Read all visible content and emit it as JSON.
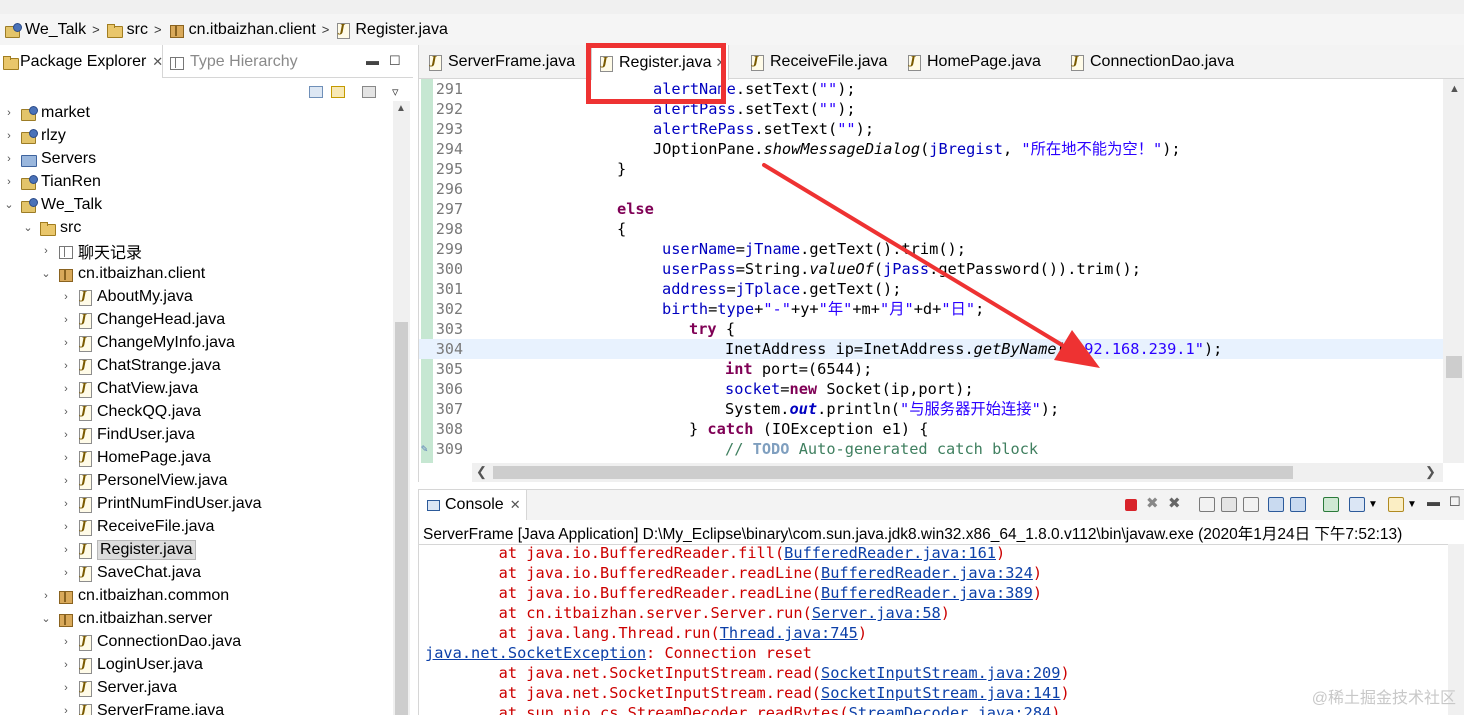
{
  "breadcrumb": [
    "We_Talk",
    "src",
    "cn.itbaizhan.client",
    "Register.java"
  ],
  "left_pane": {
    "tabs": [
      {
        "label": "Package Explorer",
        "active": true
      },
      {
        "label": "Type Hierarchy",
        "active": false
      }
    ],
    "tree": [
      {
        "label": "market",
        "icon": "project-icon",
        "expanded": false
      },
      {
        "label": "rlzy",
        "icon": "project-icon",
        "expanded": false
      },
      {
        "label": "Servers",
        "icon": "servers-folder-icon",
        "expanded": false
      },
      {
        "label": "TianRen",
        "icon": "project-icon",
        "expanded": false
      },
      {
        "label": "We_Talk",
        "icon": "project-icon",
        "expanded": true
      },
      {
        "label": "src",
        "icon": "source-folder-icon",
        "expanded": true
      },
      {
        "label": "聊天记录",
        "icon": "empty-package-icon",
        "expanded": false
      },
      {
        "label": "cn.itbaizhan.client",
        "icon": "package-icon",
        "expanded": true
      },
      {
        "label": "AboutMy.java",
        "icon": "java-file-icon"
      },
      {
        "label": "ChangeHead.java",
        "icon": "java-file-icon"
      },
      {
        "label": "ChangeMyInfo.java",
        "icon": "java-file-icon"
      },
      {
        "label": "ChatStrange.java",
        "icon": "java-file-icon"
      },
      {
        "label": "ChatView.java",
        "icon": "java-file-icon"
      },
      {
        "label": "CheckQQ.java",
        "icon": "java-file-icon"
      },
      {
        "label": "FindUser.java",
        "icon": "java-file-icon"
      },
      {
        "label": "HomePage.java",
        "icon": "java-file-icon"
      },
      {
        "label": "PersonelView.java",
        "icon": "java-file-icon"
      },
      {
        "label": "PrintNumFindUser.java",
        "icon": "java-file-icon"
      },
      {
        "label": "ReceiveFile.java",
        "icon": "java-file-icon"
      },
      {
        "label": "Register.java",
        "icon": "java-file-icon",
        "selected": true
      },
      {
        "label": "SaveChat.java",
        "icon": "java-file-icon"
      },
      {
        "label": "cn.itbaizhan.common",
        "icon": "package-icon",
        "expanded": false
      },
      {
        "label": "cn.itbaizhan.server",
        "icon": "package-icon",
        "expanded": true
      },
      {
        "label": "ConnectionDao.java",
        "icon": "java-file-icon"
      },
      {
        "label": "LoginUser.java",
        "icon": "java-file-icon"
      },
      {
        "label": "Server.java",
        "icon": "java-file-icon"
      },
      {
        "label": "ServerFrame.java",
        "icon": "java-file-icon"
      }
    ]
  },
  "editor": {
    "tabs": [
      {
        "label": "ServerFrame.java",
        "active": false
      },
      {
        "label": "Register.java",
        "active": true
      },
      {
        "label": "ReceiveFile.java",
        "active": false
      },
      {
        "label": "HomePage.java",
        "active": false
      },
      {
        "label": "ConnectionDao.java",
        "active": false
      }
    ],
    "current_line": 304,
    "lines": [
      {
        "n": "291",
        "text": "alertName.setText(\"\");"
      },
      {
        "n": "292",
        "text": "alertPass.setText(\"\");"
      },
      {
        "n": "293",
        "text": "alertRePass.setText(\"\");"
      },
      {
        "n": "294",
        "text": "JOptionPane.showMessageDialog(jBregist, \"所在地不能为空！\");"
      },
      {
        "n": "295",
        "text": "}"
      },
      {
        "n": "296",
        "text": ""
      },
      {
        "n": "297",
        "text": "else"
      },
      {
        "n": "298",
        "text": "{"
      },
      {
        "n": "299",
        "text": "userName=jTname.getText().trim();"
      },
      {
        "n": "300",
        "text": "userPass=String.valueOf(jPass.getPassword()).trim();"
      },
      {
        "n": "301",
        "text": "address=jTplace.getText();"
      },
      {
        "n": "302",
        "text": "birth=type+\"-\"+y+\"年\"+m+\"月\"+d+\"日\";"
      },
      {
        "n": "303",
        "text": "try {"
      },
      {
        "n": "304",
        "text": "InetAddress ip=InetAddress.getByName(\"192.168.239.1\");"
      },
      {
        "n": "305",
        "text": "int port=(6544);"
      },
      {
        "n": "306",
        "text": "socket=new Socket(ip,port);"
      },
      {
        "n": "307",
        "text": "System.out.println(\"与服务器开始连接\");"
      },
      {
        "n": "308",
        "text": "} catch (IOException e1) {"
      },
      {
        "n": "309",
        "text": "// TODO Auto-generated catch block"
      }
    ]
  },
  "console": {
    "tab_label": "Console",
    "description": "ServerFrame [Java Application] D:\\My_Eclipse\\binary\\com.sun.java.jdk8.win32.x86_64_1.8.0.v112\\bin\\javaw.exe (2020年1月24日 下午7:52:13)",
    "lines": [
      {
        "prefix": "        at java.io.BufferedReader.fill(",
        "link": "BufferedReader.java:161",
        "suffix": ")"
      },
      {
        "prefix": "        at java.io.BufferedReader.readLine(",
        "link": "BufferedReader.java:324",
        "suffix": ")"
      },
      {
        "prefix": "        at java.io.BufferedReader.readLine(",
        "link": "BufferedReader.java:389",
        "suffix": ")"
      },
      {
        "prefix": "        at cn.itbaizhan.server.Server.run(",
        "link": "Server.java:58",
        "suffix": ")"
      },
      {
        "prefix": "        at java.lang.Thread.run(",
        "link": "Thread.java:745",
        "suffix": ")"
      },
      {
        "prefix": "",
        "link": "java.net.SocketException",
        "suffix": ": Connection reset"
      },
      {
        "prefix": "        at java.net.SocketInputStream.read(",
        "link": "SocketInputStream.java:209",
        "suffix": ")"
      },
      {
        "prefix": "        at java.net.SocketInputStream.read(",
        "link": "SocketInputStream.java:141",
        "suffix": ")"
      },
      {
        "prefix": "        at sun.nio.cs.StreamDecoder.readBytes(",
        "link": "StreamDecoder.java:284",
        "suffix": ")"
      }
    ]
  },
  "watermark": "@稀土掘金技术社区",
  "colors": {
    "annotation_red": "#ee3232",
    "keyword": "#7f0055",
    "field": "#0000c0",
    "string": "#2a00ff",
    "error": "#cc0000",
    "link": "#0b3fa8"
  }
}
